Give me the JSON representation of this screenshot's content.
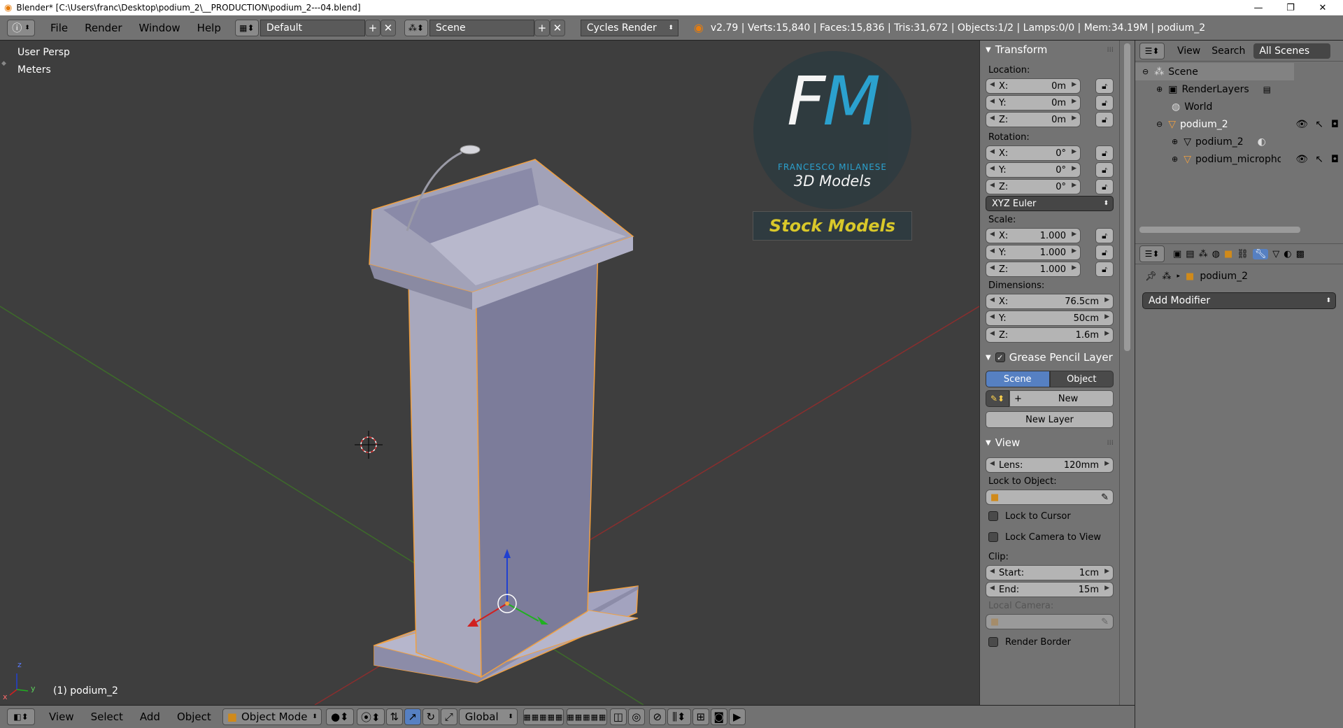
{
  "window": {
    "title": "Blender* [C:\\Users\\franc\\Desktop\\podium_2\\__PRODUCTION\\podium_2---04.blend]",
    "minimize": "—",
    "maximize": "❐",
    "close": "✕"
  },
  "topbar": {
    "menus": [
      "File",
      "Render",
      "Window",
      "Help"
    ],
    "layout": "Default",
    "scene": "Scene",
    "engine": "Cycles Render",
    "info": "v2.79 | Verts:15,840 | Faces:15,836 | Tris:31,672 | Objects:1/2 | Lamps:0/0 | Mem:34.19M | podium_2"
  },
  "viewport": {
    "view_name": "User Persp",
    "units": "Meters",
    "object_label": "(1) podium_2",
    "logo": {
      "letters": "FM",
      "author": "FRANCESCO MILANESE",
      "subtitle": "3D Models",
      "banner": "Stock Models"
    },
    "axis_x": "x",
    "axis_y": "y",
    "axis_z": "z"
  },
  "transform": {
    "header": "Transform",
    "location_label": "Location:",
    "location": [
      {
        "k": "X:",
        "v": "0m"
      },
      {
        "k": "Y:",
        "v": "0m"
      },
      {
        "k": "Z:",
        "v": "0m"
      }
    ],
    "rotation_label": "Rotation:",
    "rotation": [
      {
        "k": "X:",
        "v": "0°"
      },
      {
        "k": "Y:",
        "v": "0°"
      },
      {
        "k": "Z:",
        "v": "0°"
      }
    ],
    "rotation_mode": "XYZ Euler",
    "scale_label": "Scale:",
    "scale": [
      {
        "k": "X:",
        "v": "1.000"
      },
      {
        "k": "Y:",
        "v": "1.000"
      },
      {
        "k": "Z:",
        "v": "1.000"
      }
    ],
    "dimensions_label": "Dimensions:",
    "dimensions": [
      {
        "k": "X:",
        "v": "76.5cm"
      },
      {
        "k": "Y:",
        "v": "50cm"
      },
      {
        "k": "Z:",
        "v": "1.6m"
      }
    ]
  },
  "grease_pencil": {
    "header": "Grease Pencil Layer",
    "tab_scene": "Scene",
    "tab_object": "Object",
    "new": "New",
    "new_layer": "New Layer"
  },
  "view_panel": {
    "header": "View",
    "lens_label": "Lens:",
    "lens": "120mm",
    "lock_to_object": "Lock to Object:",
    "lock_to_cursor": "Lock to Cursor",
    "lock_camera": "Lock Camera to View",
    "clip_label": "Clip:",
    "clip_start_label": "Start:",
    "clip_start": "1cm",
    "clip_end_label": "End:",
    "clip_end": "15m",
    "local_camera": "Local Camera:",
    "render_border": "Render Border"
  },
  "outliner": {
    "view": "View",
    "search": "Search",
    "filter": "All Scenes",
    "items": {
      "scene": "Scene",
      "renderlayers": "RenderLayers",
      "world": "World",
      "podium": "podium_2",
      "podium_mesh": "podium_2",
      "microphone": "podium_microphon"
    }
  },
  "properties": {
    "object_name": "podium_2",
    "add_modifier": "Add Modifier"
  },
  "bottombar": {
    "menus": [
      "View",
      "Select",
      "Add",
      "Object"
    ],
    "mode": "Object Mode",
    "orientation": "Global"
  },
  "colors": {
    "accent_blue": "#5680c2",
    "selection_orange": "#f1a040",
    "logo_cyan": "#2aa7d6",
    "banner_yellow": "#d9c82a"
  }
}
